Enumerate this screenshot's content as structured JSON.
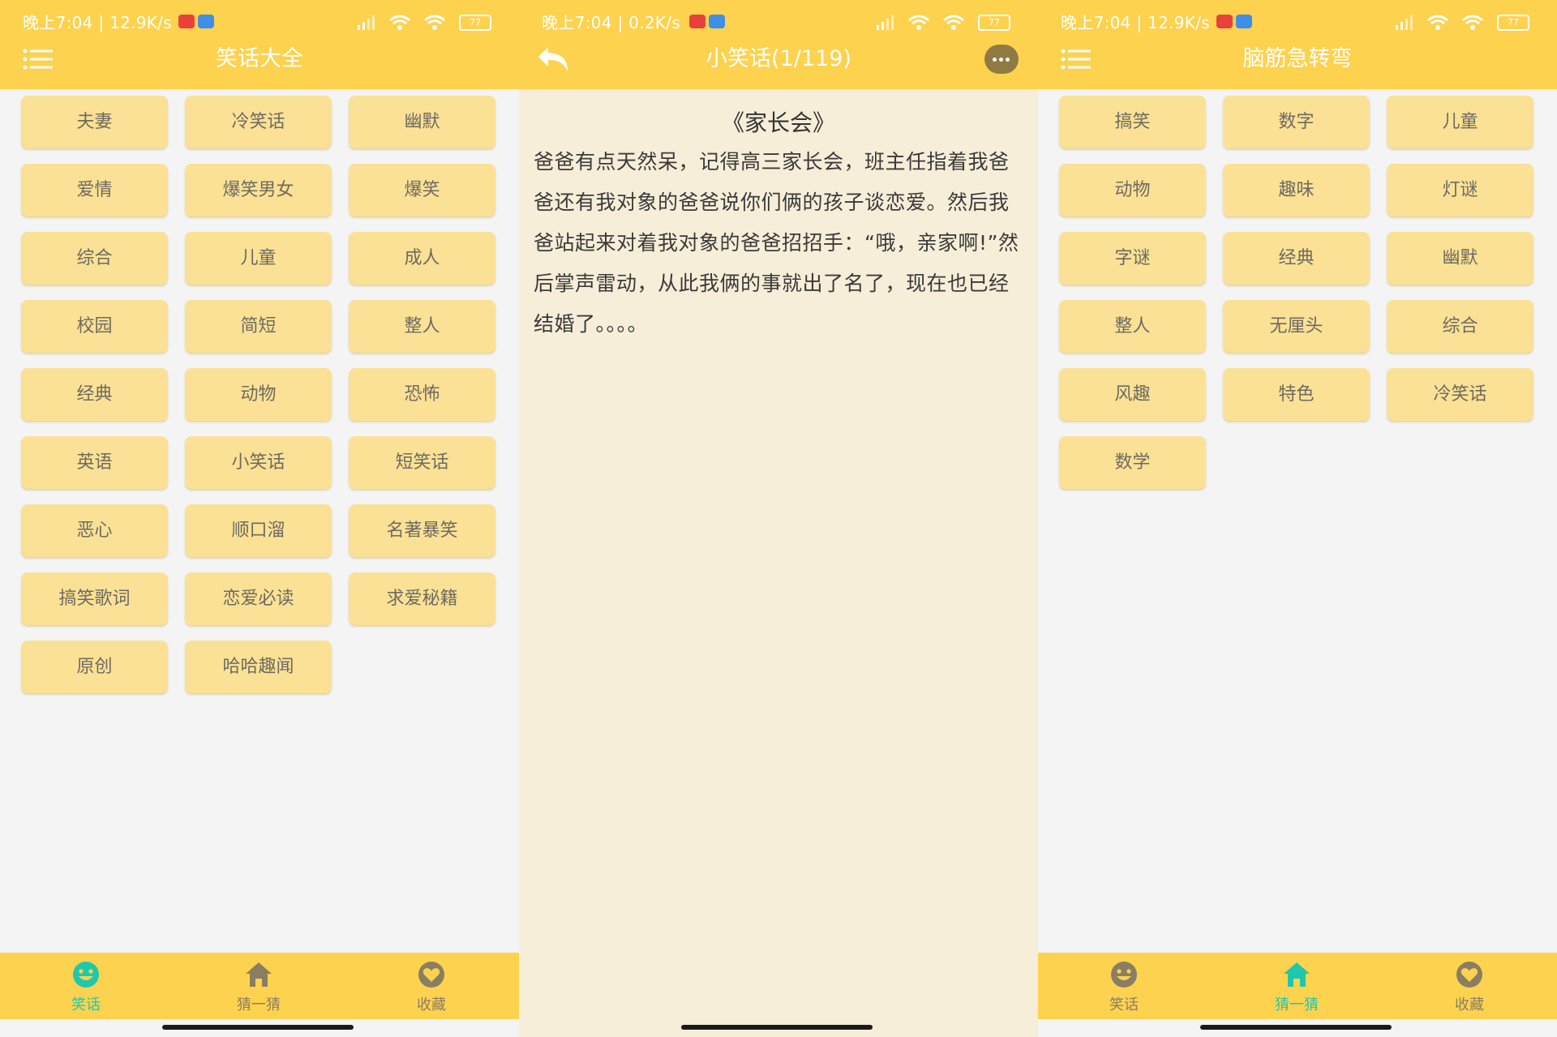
{
  "colors": {
    "accent": "#fdd24f",
    "button": "#fae195",
    "tab_active": "#1fc8ad",
    "reader_bg": "#f7eed9"
  },
  "screens": [
    {
      "status": {
        "time": "晚上7:04 | 12.9K/s",
        "battery": "77"
      },
      "header": {
        "title": "笑话大全",
        "left_icon": "menu-icon"
      },
      "categories": [
        "夫妻",
        "冷笑话",
        "幽默",
        "爱情",
        "爆笑男女",
        "爆笑",
        "综合",
        "儿童",
        "成人",
        "校园",
        "简短",
        "整人",
        "经典",
        "动物",
        "恐怖",
        "英语",
        "小笑话",
        "短笑话",
        "恶心",
        "顺口溜",
        "名著暴笑",
        "搞笑歌词",
        "恋爱必读",
        "求爱秘籍",
        "原创",
        "哈哈趣闻"
      ],
      "tabs": [
        {
          "label": "笑话",
          "icon": "smiley-icon",
          "active": true
        },
        {
          "label": "猜一猜",
          "icon": "home-icon",
          "active": false
        },
        {
          "label": "收藏",
          "icon": "heart-icon",
          "active": false
        }
      ]
    },
    {
      "status": {
        "time": "晚上7:04 | 0.2K/s",
        "battery": "77"
      },
      "header": {
        "title": "小笑话(1/119)",
        "left_icon": "back-icon",
        "right_icon": "more-icon"
      },
      "joke": {
        "title": "《家长会》",
        "body": "爸爸有点天然呆，记得高三家长会，班主任指着我爸爸还有我对象的爸爸说你们俩的孩子谈恋爱。然后我爸站起来对着我对象的爸爸招招手：“哦，亲家啊!”然后掌声雷动，从此我俩的事就出了名了，现在也已经结婚了。。。。"
      }
    },
    {
      "status": {
        "time": "晚上7:04 | 12.9K/s",
        "battery": "77"
      },
      "header": {
        "title": "脑筋急转弯",
        "left_icon": "menu-icon"
      },
      "categories": [
        "搞笑",
        "数字",
        "儿童",
        "动物",
        "趣味",
        "灯谜",
        "字谜",
        "经典",
        "幽默",
        "整人",
        "无厘头",
        "综合",
        "风趣",
        "特色",
        "冷笑话",
        "数学"
      ],
      "tabs": [
        {
          "label": "笑话",
          "icon": "smiley-icon",
          "active": false
        },
        {
          "label": "猜一猜",
          "icon": "home-icon",
          "active": true
        },
        {
          "label": "收藏",
          "icon": "heart-icon",
          "active": false
        }
      ]
    }
  ]
}
